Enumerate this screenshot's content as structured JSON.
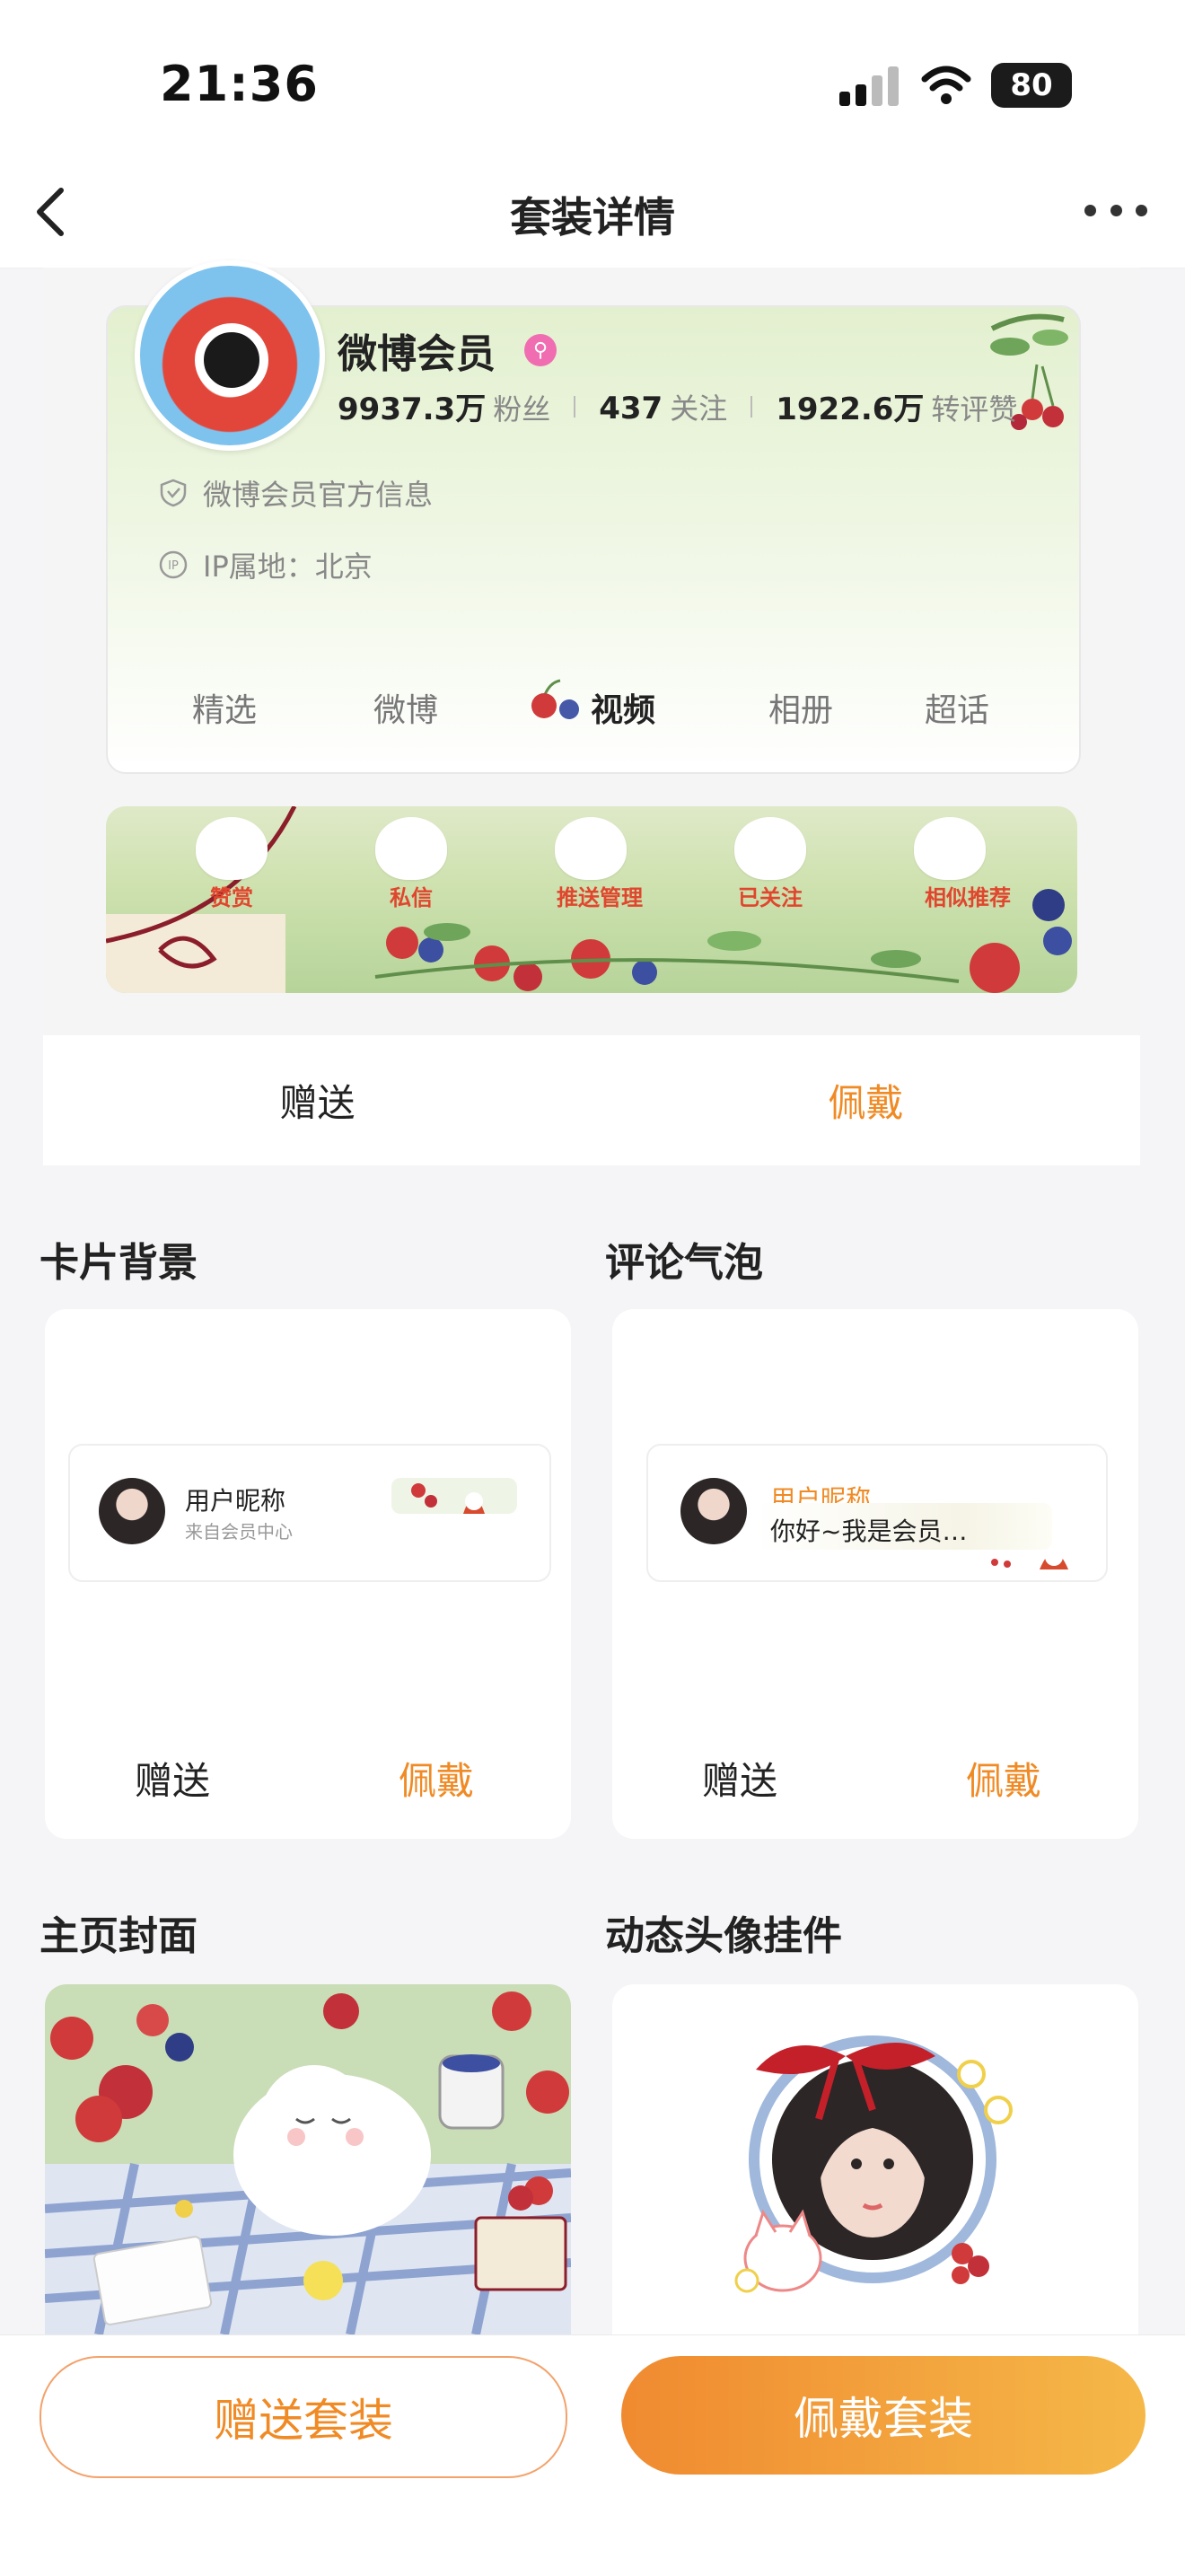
{
  "status_bar": {
    "time": "21:36",
    "battery": "80"
  },
  "nav": {
    "title": "套装详情"
  },
  "profile": {
    "name": "微博会员",
    "stats": [
      {
        "value": "9937.3万",
        "label": "粉丝"
      },
      {
        "value": "437",
        "label": "关注"
      },
      {
        "value": "1922.6万",
        "label": "转评赞"
      }
    ],
    "info_official": "微博会员官方信息",
    "info_ip": "IP属地：北京",
    "tabs": [
      "精选",
      "微博",
      "视频",
      "相册",
      "超话"
    ],
    "active_tab": "视频"
  },
  "action_bar": {
    "items": [
      "赞赏",
      "私信",
      "推送管理",
      "已关注",
      "相似推荐"
    ]
  },
  "suit_buttons": {
    "gift": "赠送",
    "wear": "佩戴"
  },
  "sections": {
    "card_bg": {
      "title": "卡片背景",
      "nickname": "用户昵称",
      "source": "来自会员中心",
      "gift": "赠送",
      "wear": "佩戴"
    },
    "comment_bubble": {
      "title": "评论气泡",
      "nickname": "用户昵称",
      "text": "你好~我是会员…",
      "gift": "赠送",
      "wear": "佩戴"
    },
    "cover": {
      "title": "主页封面"
    },
    "pendant": {
      "title": "动态头像挂件"
    }
  },
  "bottom": {
    "gift_suit": "赠送套装",
    "wear_suit": "佩戴套装"
  },
  "colors": {
    "accent": "#f08a24",
    "gradient_end": "#f5b848",
    "action_red": "#e0462e"
  }
}
